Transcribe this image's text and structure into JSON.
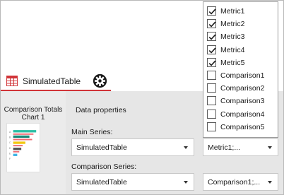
{
  "tab": {
    "label": "SimulatedTable"
  },
  "thumbnail": {
    "title": "Comparison Totals Chart 1"
  },
  "properties": {
    "title": "Data properties",
    "main_series_label": "Main Series:",
    "main_series_value": "SimulatedTable",
    "metrics_value": "Metric1;...",
    "comparison_series_label": "Comparison Series:",
    "comparison_series_value": "SimulatedTable",
    "comparison_metrics_value": "Comparison1;..."
  },
  "dropdown": {
    "options": [
      {
        "label": "Metric1",
        "checked": true
      },
      {
        "label": "Metric2",
        "checked": true
      },
      {
        "label": "Metric3",
        "checked": true
      },
      {
        "label": "Metric4",
        "checked": true
      },
      {
        "label": "Metric5",
        "checked": true
      },
      {
        "label": "Comparison1",
        "checked": false
      },
      {
        "label": "Comparison2",
        "checked": false
      },
      {
        "label": "Comparison3",
        "checked": false
      },
      {
        "label": "Comparison4",
        "checked": false
      },
      {
        "label": "Comparison5",
        "checked": false
      }
    ]
  },
  "colors": {
    "accent": "#d13438"
  }
}
